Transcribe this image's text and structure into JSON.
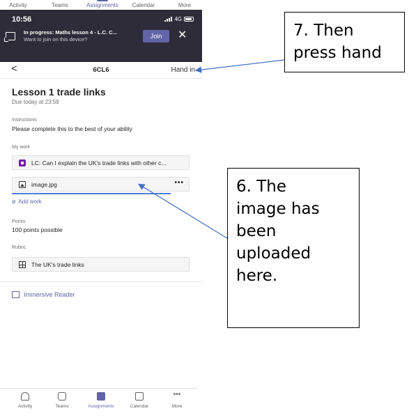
{
  "top_nav": {
    "items": [
      {
        "label": "Activity",
        "active": false
      },
      {
        "label": "Teams",
        "active": false
      },
      {
        "label": "Assignments",
        "active": true
      },
      {
        "label": "Calendar",
        "active": false
      },
      {
        "label": "More",
        "active": false
      }
    ]
  },
  "status_bar": {
    "time": "10:56",
    "network": "4G"
  },
  "banner": {
    "title": "In progress: Maths lesson 4 - L.C. C...",
    "subtitle": "Want to join on this device?",
    "join_label": "Join",
    "close_glyph": "✕"
  },
  "header": {
    "back_glyph": "<",
    "title": "6CL6",
    "hand_in_label": "Hand in"
  },
  "assignment": {
    "title": "Lesson 1 trade links",
    "due": "Due today at 23:59",
    "instructions_label": "Instructions",
    "instructions_text": "Please complete this to the best of your ability",
    "my_work_label": "My work",
    "work_items": [
      {
        "icon": "onenote-icon",
        "text": "LC:  Can I explain the UK's trade links with other c..."
      },
      {
        "icon": "image-icon",
        "text": "image.jpg",
        "more": "•••"
      }
    ],
    "add_work_label": "Add work",
    "points_label": "Points",
    "points_text": "100 points possible",
    "rubric_label": "Rubric",
    "rubric_item": "The UK's trade links",
    "immersive_reader_label": "Immersive Reader"
  },
  "bottom_nav": {
    "items": [
      {
        "label": "Activity",
        "icon": "bell-icon",
        "active": false
      },
      {
        "label": "Teams",
        "icon": "teams-icon",
        "active": false
      },
      {
        "label": "Assignments",
        "icon": "assignments-icon",
        "active": true
      },
      {
        "label": "Calendar",
        "icon": "calendar-icon",
        "active": false
      },
      {
        "label": "More",
        "icon": "more-dots-icon",
        "active": false
      }
    ]
  },
  "annotations": {
    "step7": [
      "7. Then",
      "press hand"
    ],
    "step6": [
      "6. The",
      "image has",
      "been",
      "uploaded",
      "here."
    ]
  },
  "colors": {
    "accent": "#6264a7",
    "banner_bg": "#2d2c38",
    "progress": "#4f7ad9",
    "onenote": "#7719aa"
  }
}
